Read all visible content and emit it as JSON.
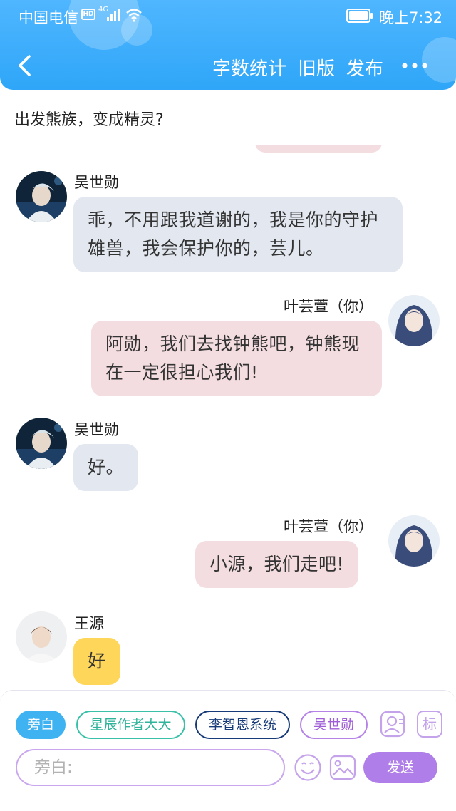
{
  "status_bar": {
    "carrier": "中国电信",
    "hd": "HD",
    "network": "4G",
    "time": "晚上7:32"
  },
  "nav": {
    "word_count": "字数统计",
    "old_version": "旧版",
    "publish": "发布"
  },
  "subtitle": "出发熊族，变成精灵?",
  "messages": [
    {
      "sender": "吴世勋",
      "side": "left",
      "text": "乖，不用跟我道谢的，我是你的守护雄兽，我会保护你的，芸儿。"
    },
    {
      "sender": "叶芸萱（你）",
      "side": "right",
      "text": "阿勋，我们去找钟熊吧，钟熊现在一定很担心我们!"
    },
    {
      "sender": "吴世勋",
      "side": "left",
      "text": "好。"
    },
    {
      "sender": "叶芸萱（你）",
      "side": "right",
      "text": "小源，我们走吧!"
    },
    {
      "sender": "王源",
      "side": "left",
      "text": "好"
    }
  ],
  "composer": {
    "roles": [
      "旁白",
      "星辰作者大大",
      "李智恩系统",
      "吴世勋"
    ],
    "tag_icon_label": "标",
    "input_placeholder": "旁白:",
    "send_label": "发送"
  },
  "colors": {
    "header": "#2fa6f8",
    "left_bubble": "#e3e8f0",
    "right_bubble": "#f4dde0",
    "yellow_bubble": "#fed75a",
    "send_button": "#b07ee8"
  }
}
